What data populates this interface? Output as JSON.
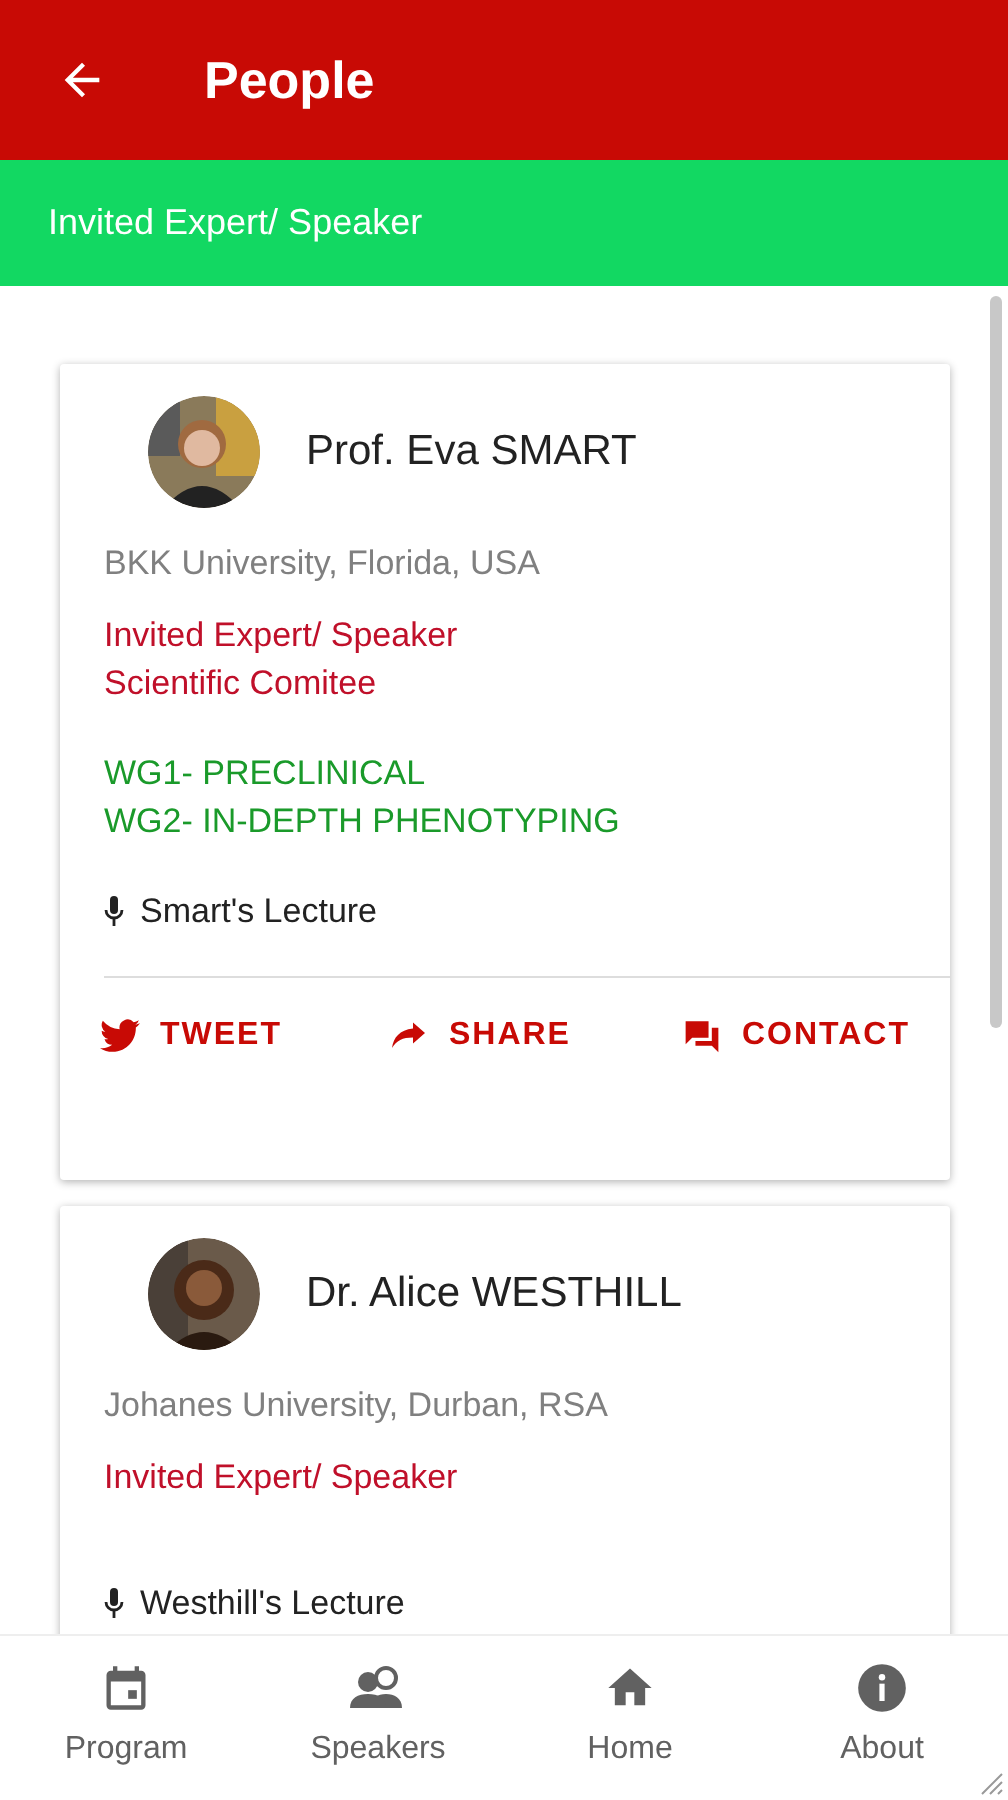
{
  "app_bar": {
    "title": "People"
  },
  "filter_bar": {
    "label": "Invited Expert/ Speaker"
  },
  "people": [
    {
      "avatar": {
        "kind": "picture"
      },
      "name": "Prof. Eva SMART",
      "affiliation": "BKK University, Florida, USA",
      "roles": [
        "Invited Expert/ Speaker",
        "Scientific Comitee"
      ],
      "groups": [
        "WG1- PRECLINICAL",
        "WG2- IN-DEPTH PHENOTYPING"
      ],
      "lecture": "Smart's Lecture",
      "actions": [
        {
          "kind": "tweet",
          "label": "TWEET"
        },
        {
          "kind": "share",
          "label": "SHARE"
        },
        {
          "kind": "contact",
          "label": "CONTACT"
        }
      ]
    },
    {
      "avatar": {
        "kind": "picture"
      },
      "name": "Dr. Alice WESTHILL",
      "affiliation": "Johanes University, Durban, RSA",
      "roles": [
        "Invited Expert/ Speaker"
      ],
      "lecture": "Westhill's Lecture"
    }
  ],
  "bottom_nav": [
    {
      "kind": "program",
      "label": "Program"
    },
    {
      "kind": "speakers",
      "label": "Speakers"
    },
    {
      "kind": "home",
      "label": "Home"
    },
    {
      "kind": "about",
      "label": "About"
    }
  ]
}
